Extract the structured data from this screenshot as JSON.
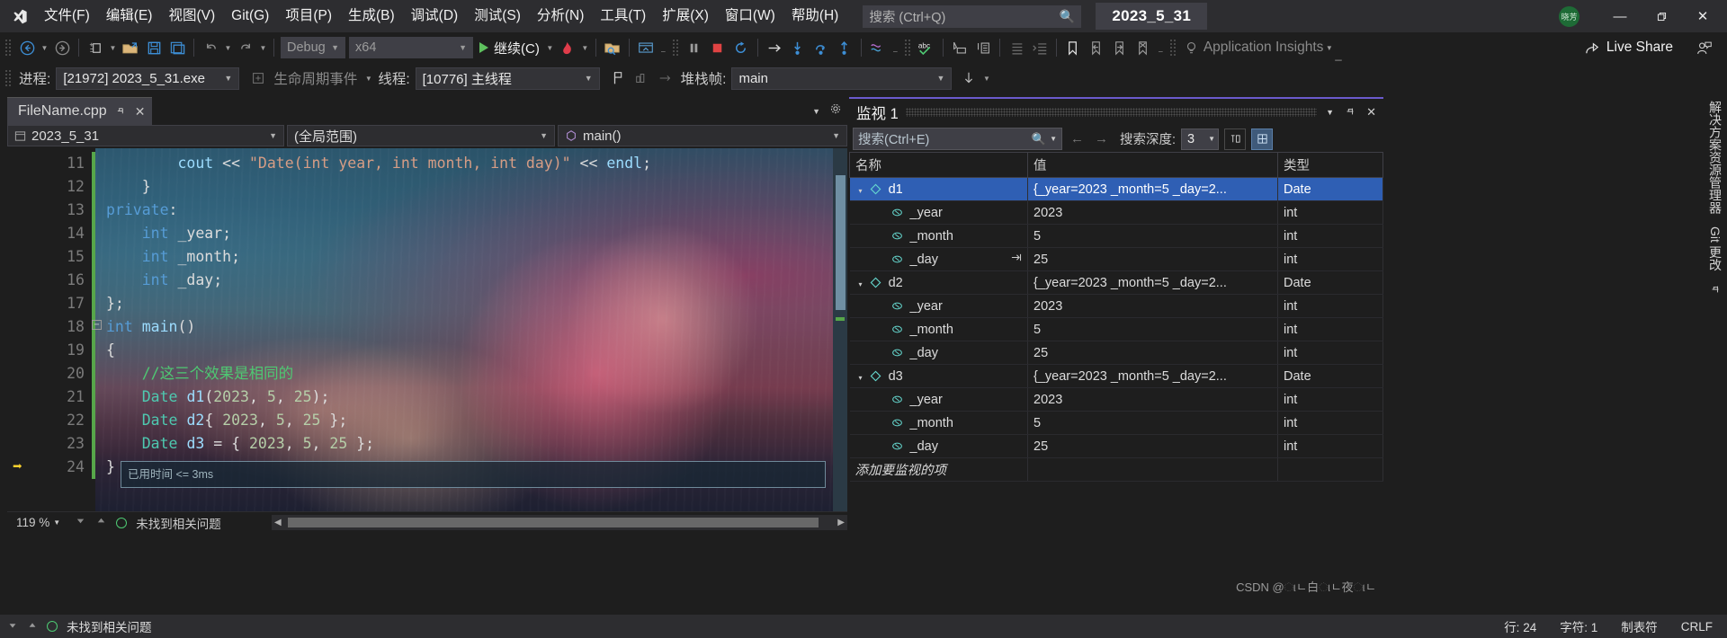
{
  "app": {
    "title_chip": "2023_5_31",
    "avatar_initials": "晓芳"
  },
  "menubar": {
    "logo_name": "visual-studio-logo",
    "items": [
      {
        "label": "文件(F)"
      },
      {
        "label": "编辑(E)"
      },
      {
        "label": "视图(V)"
      },
      {
        "label": "Git(G)"
      },
      {
        "label": "项目(P)"
      },
      {
        "label": "生成(B)"
      },
      {
        "label": "调试(D)"
      },
      {
        "label": "测试(S)"
      },
      {
        "label": "分析(N)"
      },
      {
        "label": "工具(T)"
      },
      {
        "label": "扩展(X)"
      },
      {
        "label": "窗口(W)"
      },
      {
        "label": "帮助(H)"
      }
    ],
    "search_placeholder": "搜索 (Ctrl+Q)",
    "minimize": "—",
    "maximize": "❐",
    "close": "✕"
  },
  "toolbar": {
    "config": "Debug",
    "platform": "x64",
    "continue_label": "继续(C)",
    "app_insights": "Application Insights",
    "live_share": "Live Share",
    "overflow": "▾"
  },
  "debugbar": {
    "process_label": "进程:",
    "process_value": "[21972] 2023_5_31.exe",
    "lifecycle_label": "生命周期事件",
    "thread_label": "线程:",
    "thread_value": "[10776] 主线程",
    "stackframe_label": "堆栈帧:",
    "stackframe_value": "main"
  },
  "editor": {
    "tab_name": "FileName.cpp",
    "tab_pin": "✒",
    "tab_close": "✕",
    "nav_project": "2023_5_31",
    "nav_scope": "(全局范围)",
    "nav_member": "main()",
    "time_tip": "已用时间 <= 3ms",
    "zoom": "119 %",
    "error_status": "未找到相关问题",
    "lines": [
      {
        "n": "11",
        "code": "        cout << \"Date(int year, int month, int day)\" << endl;",
        "changed": true
      },
      {
        "n": "12",
        "code": "    }",
        "changed": true
      },
      {
        "n": "13",
        "code": "private:",
        "changed": true
      },
      {
        "n": "14",
        "code": "    int _year;",
        "changed": true
      },
      {
        "n": "15",
        "code": "    int _month;",
        "changed": true
      },
      {
        "n": "16",
        "code": "    int _day;",
        "changed": true
      },
      {
        "n": "17",
        "code": "};",
        "changed": true
      },
      {
        "n": "18",
        "code": "int main()",
        "changed": true
      },
      {
        "n": "19",
        "code": "{",
        "changed": true
      },
      {
        "n": "20",
        "code": "    //这三个效果是相同的",
        "changed": true
      },
      {
        "n": "21",
        "code": "    Date d1(2023, 5, 25);",
        "changed": true
      },
      {
        "n": "22",
        "code": "    Date d2{ 2023, 5, 25 };",
        "changed": true
      },
      {
        "n": "23",
        "code": "    Date d3 = { 2023, 5, 25 };",
        "changed": true
      },
      {
        "n": "24",
        "code": "}",
        "changed": true
      }
    ]
  },
  "watch": {
    "panel_title": "监视 1",
    "search_placeholder": "搜索(Ctrl+E)",
    "depth_label": "搜索深度:",
    "depth_value": "3",
    "columns": [
      "名称",
      "值",
      "类型"
    ],
    "add_row": "添加要监视的项",
    "rows": [
      {
        "indent": 0,
        "expander": "▾",
        "name": "d1",
        "value": "{_year=2023 _month=5 _day=2...",
        "type": "Date",
        "selected": true,
        "refresh": false
      },
      {
        "indent": 1,
        "expander": "",
        "name": "_year",
        "value": "2023",
        "type": "int",
        "selected": false,
        "refresh": false
      },
      {
        "indent": 1,
        "expander": "",
        "name": "_month",
        "value": "5",
        "type": "int",
        "selected": false,
        "refresh": false
      },
      {
        "indent": 1,
        "expander": "",
        "name": "_day",
        "value": "25",
        "type": "int",
        "selected": false,
        "refresh": true
      },
      {
        "indent": 0,
        "expander": "▾",
        "name": "d2",
        "value": "{_year=2023 _month=5 _day=2...",
        "type": "Date",
        "selected": false,
        "refresh": false
      },
      {
        "indent": 1,
        "expander": "",
        "name": "_year",
        "value": "2023",
        "type": "int",
        "selected": false,
        "refresh": false
      },
      {
        "indent": 1,
        "expander": "",
        "name": "_month",
        "value": "5",
        "type": "int",
        "selected": false,
        "refresh": false
      },
      {
        "indent": 1,
        "expander": "",
        "name": "_day",
        "value": "25",
        "type": "int",
        "selected": false,
        "refresh": false
      },
      {
        "indent": 0,
        "expander": "▾",
        "name": "d3",
        "value": "{_year=2023 _month=5 _day=2...",
        "type": "Date",
        "selected": false,
        "refresh": false
      },
      {
        "indent": 1,
        "expander": "",
        "name": "_year",
        "value": "2023",
        "type": "int",
        "selected": false,
        "refresh": false
      },
      {
        "indent": 1,
        "expander": "",
        "name": "_month",
        "value": "5",
        "type": "int",
        "selected": false,
        "refresh": false
      },
      {
        "indent": 1,
        "expander": "",
        "name": "_day",
        "value": "25",
        "type": "int",
        "selected": false,
        "refresh": false
      }
    ]
  },
  "right_tabs": [
    {
      "label": "解决方案资源管理器"
    },
    {
      "label": "Git 更改"
    }
  ],
  "statusbar": {
    "error_text": "未找到相关问题",
    "row_label": "行: 24",
    "col_label": "字符: 1",
    "tab_label": "制表符",
    "eol_label": "CRLF"
  },
  "watermark": "CSDN @ાㄴ白ાㄴ夜ાㄴ",
  "colors": {
    "accent_purple": "#6a5acd",
    "selection_blue": "#2f5fb4",
    "comment_green": "#4ec973",
    "type_teal": "#4ec9b0",
    "keyword_blue": "#569cd6",
    "number_green": "#b5cea8",
    "changebar_green": "#57a64a",
    "play_green": "#5ec15e",
    "stop_red": "#e04343"
  }
}
